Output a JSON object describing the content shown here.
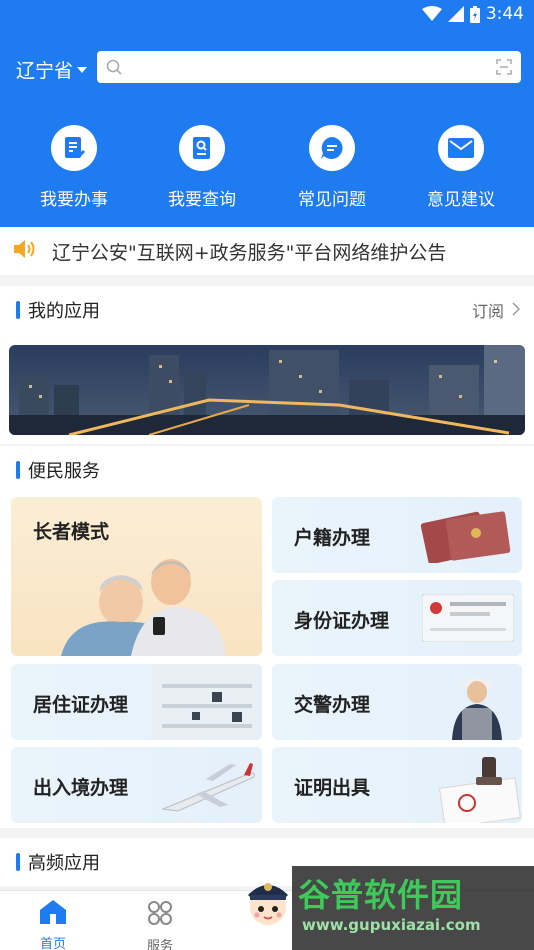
{
  "status_bar": {
    "time": "3:44"
  },
  "header": {
    "region": "辽宁省",
    "search": {
      "placeholder": ""
    },
    "quick_actions": [
      {
        "label": "我要办事",
        "icon": "doc-edit-icon"
      },
      {
        "label": "我要查询",
        "icon": "doc-search-icon"
      },
      {
        "label": "常见问题",
        "icon": "chat-bubble-icon"
      },
      {
        "label": "意见建议",
        "icon": "envelope-icon"
      }
    ]
  },
  "notice": {
    "text": "辽宁公安\"互联网+政务服务\"平台网络维护公告"
  },
  "my_apps": {
    "title": "我的应用",
    "subscribe_label": "订阅"
  },
  "convenience": {
    "title": "便民服务",
    "cards": [
      {
        "label": "长者模式"
      },
      {
        "label": "户籍办理"
      },
      {
        "label": "身份证办理"
      },
      {
        "label": "居住证办理"
      },
      {
        "label": "交警办理"
      },
      {
        "label": "出入境办理"
      },
      {
        "label": "证明出具"
      }
    ]
  },
  "frequent": {
    "title": "高频应用"
  },
  "bottom_nav": {
    "items": [
      {
        "label": "首页",
        "active": true
      },
      {
        "label": "服务",
        "active": false
      }
    ]
  },
  "watermark": {
    "title": "谷普软件园",
    "url": "www.gupuxiazai.com"
  },
  "colors": {
    "primary": "#1f7cf0",
    "notice_icon": "#f5a623"
  }
}
